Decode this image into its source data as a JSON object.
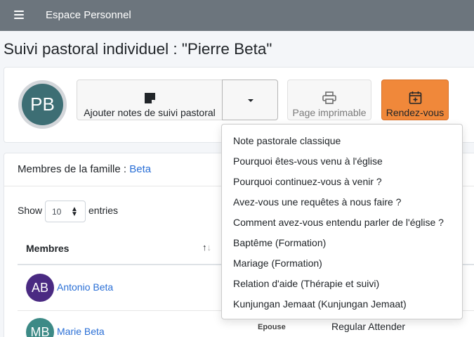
{
  "header": {
    "brand": "Espace Personnel",
    "menu_icon": "hamburger-icon",
    "color": "#6c757d"
  },
  "page": {
    "title": "Suivi pastoral individuel : \"Pierre Beta\""
  },
  "profile": {
    "initials": "PB",
    "avatar_color": "#3d6e74"
  },
  "toolbar": {
    "notes_label": "Ajouter notes de suivi pastoral",
    "notes_icon": "sticky-note-icon",
    "caret_icon": "caret-down-icon",
    "print_label": "Page imprimable",
    "print_icon": "printer-icon",
    "appointment_label": "Rendez-vous",
    "appointment_icon": "calendar-plus-icon",
    "appointment_color": "#f0883a"
  },
  "dropdown": {
    "items": [
      "Note pastorale classique",
      "Pourquoi êtes-vous venu à l'église",
      "Pourquoi continuez-vous à venir ?",
      "Avez-vous une requêtes à nous faire ?",
      "Comment avez-vous entendu parler de l'église ?",
      "Baptême (Formation)",
      "Mariage (Formation)",
      "Relation d'aide (Thérapie et suivi)",
      "Kunjungan Jemaat (Kunjungan Jemaat)"
    ]
  },
  "family": {
    "title_prefix": "Membres de la famille : ",
    "family_name": "Beta",
    "show_label": "Show",
    "entries_value": "10",
    "entries_label": "entries",
    "column_header": "Membres",
    "rows": [
      {
        "initials": "AB",
        "name": "Antonio Beta",
        "avatar_color": "#4a2a82",
        "role": "",
        "status": ""
      },
      {
        "initials": "MB",
        "name": "Marie Beta",
        "avatar_color": "#3d8a86",
        "role": "Epouse",
        "status": "Regular Attender"
      }
    ]
  }
}
